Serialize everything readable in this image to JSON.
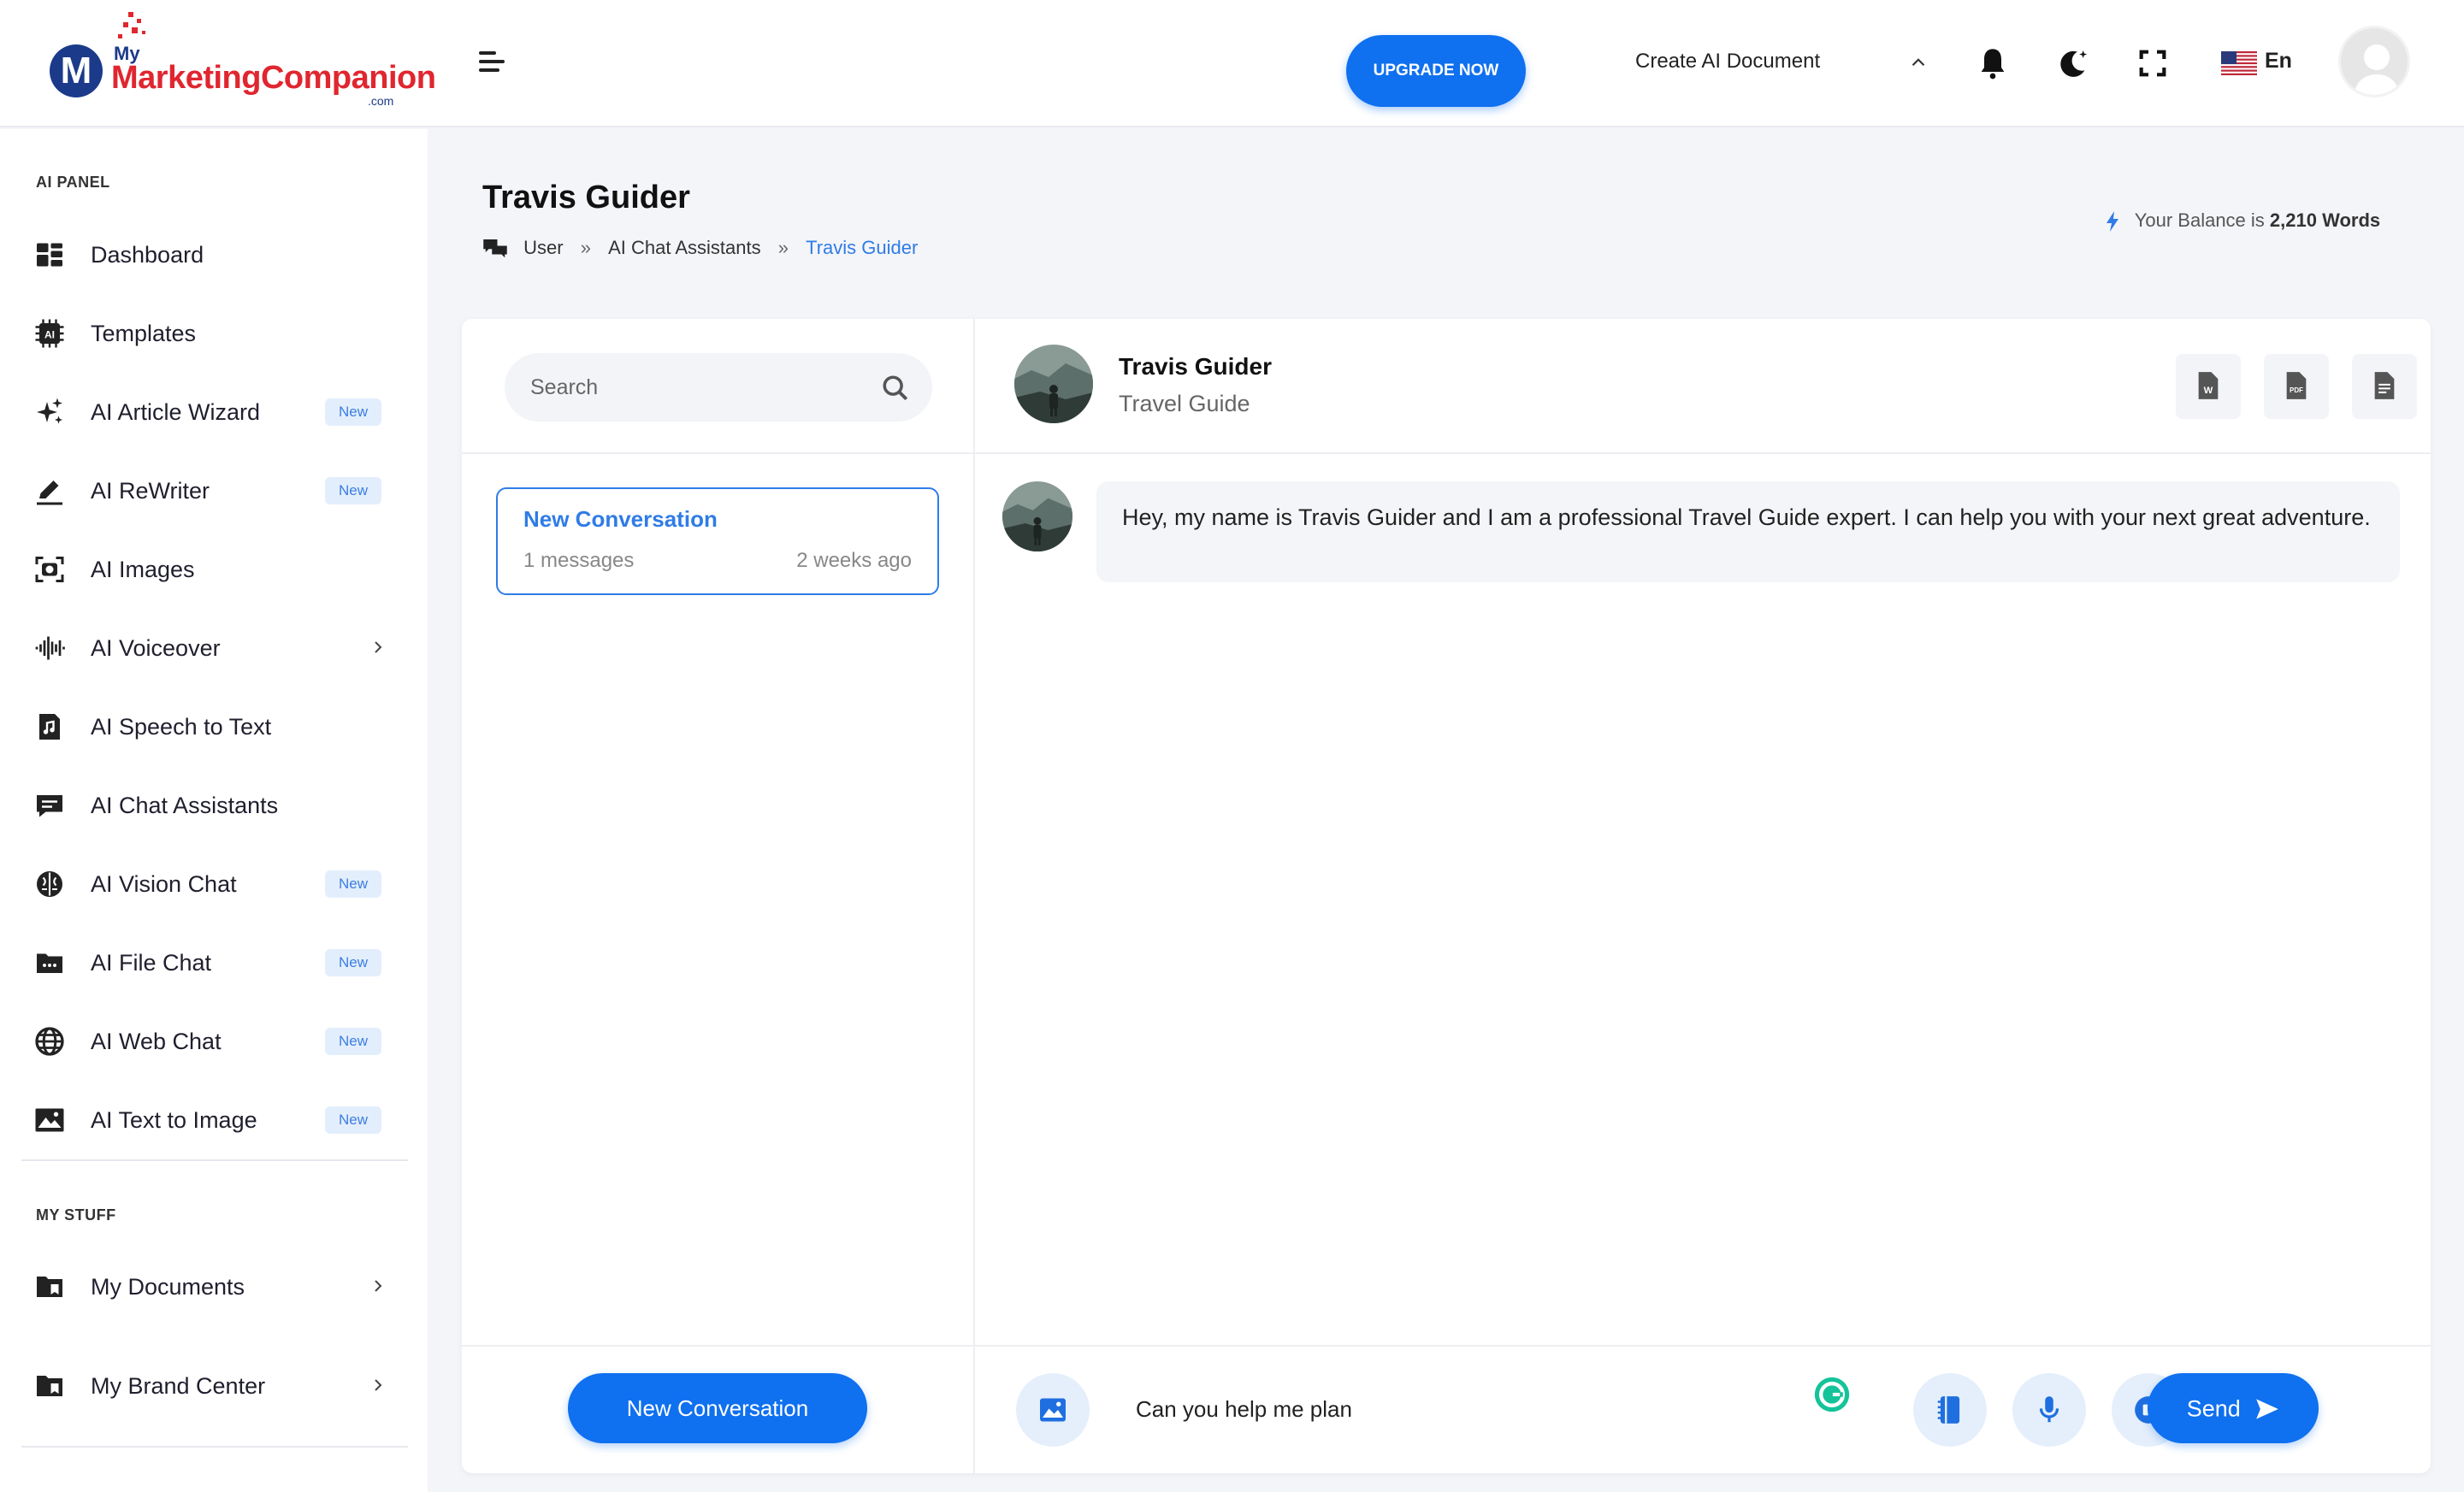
{
  "brand": {
    "my": "My",
    "name": "MarketingCompanion",
    "tld": ".com",
    "mark": "M"
  },
  "header": {
    "upgrade_label": "UPGRADE NOW",
    "create_doc_label": "Create AI Document",
    "language": "En"
  },
  "sidebar": {
    "panel_title": "AI PANEL",
    "items": [
      {
        "label": "Dashboard",
        "icon": "dashboard-icon",
        "badge": ""
      },
      {
        "label": "Templates",
        "icon": "templates-icon",
        "badge": ""
      },
      {
        "label": "AI Article Wizard",
        "icon": "sparkle-icon",
        "badge": "New"
      },
      {
        "label": "AI ReWriter",
        "icon": "pen-icon",
        "badge": "New"
      },
      {
        "label": "AI Images",
        "icon": "camera-icon",
        "badge": ""
      },
      {
        "label": "AI Voiceover",
        "icon": "waveform-icon",
        "badge": ""
      },
      {
        "label": "AI Speech to Text",
        "icon": "music-file-icon",
        "badge": ""
      },
      {
        "label": "AI Chat Assistants",
        "icon": "chat-icon",
        "badge": ""
      },
      {
        "label": "AI Vision Chat",
        "icon": "brain-icon",
        "badge": "New"
      },
      {
        "label": "AI File Chat",
        "icon": "folder-icon",
        "badge": "New"
      },
      {
        "label": "AI Web Chat",
        "icon": "globe-icon",
        "badge": "New"
      },
      {
        "label": "AI Text to Image",
        "icon": "image-icon",
        "badge": "New"
      }
    ],
    "stuff_title": "MY STUFF",
    "stuff_items": [
      {
        "label": "My Documents",
        "icon": "documents-folder-icon"
      },
      {
        "label": "My Brand Center",
        "icon": "brand-folder-icon"
      }
    ]
  },
  "page": {
    "title": "Travis Guider",
    "breadcrumb": [
      "User",
      "AI Chat Assistants",
      "Travis Guider"
    ],
    "breadcrumb_sep": "»",
    "balance_prefix": "Your Balance is",
    "balance_value": "2,210 Words"
  },
  "conversations": {
    "search_placeholder": "Search",
    "items": [
      {
        "title": "New Conversation",
        "count": "1 messages",
        "time": "2 weeks ago"
      }
    ],
    "new_button_label": "New Conversation"
  },
  "chat": {
    "assistant_name": "Travis Guider",
    "assistant_role": "Travel Guide",
    "messages": [
      {
        "sender": "assistant",
        "text": "Hey, my name is Travis Guider and I am a professional Travel Guide expert. I can help you with your next great adventure."
      }
    ],
    "input_value": "Can you help me plan",
    "send_label": "Send"
  },
  "colors": {
    "accent": "#0f70f0",
    "link": "#2f7ce6",
    "brand_red": "#e0262f",
    "brand_navy": "#1b3a8a",
    "badge_bg": "#e3eefc"
  }
}
